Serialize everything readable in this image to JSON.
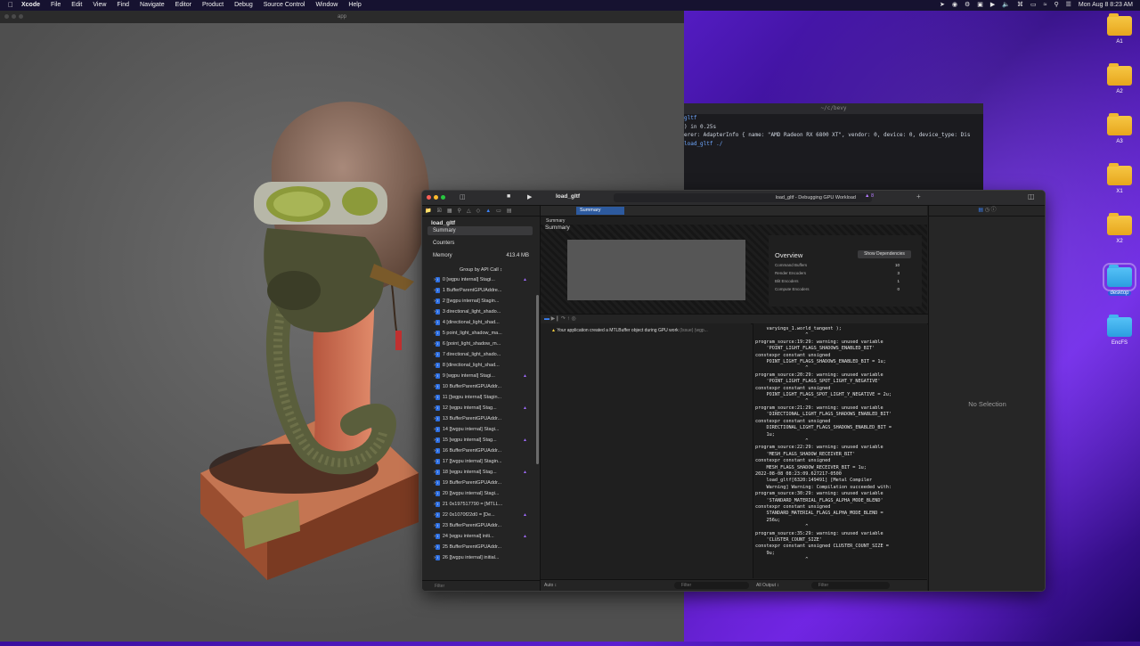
{
  "menubar": {
    "app": "Xcode",
    "items": [
      "File",
      "Edit",
      "View",
      "Find",
      "Navigate",
      "Editor",
      "Product",
      "Debug",
      "Source Control",
      "Window",
      "Help"
    ],
    "clock": "Mon Aug 8  8:23 AM"
  },
  "viewer": {
    "title": "app"
  },
  "terminal": {
    "title": "~/c/bevy",
    "lines": [
      {
        "text": "gltf",
        "blue": true
      },
      {
        "text": ") in 0.25s",
        "blue": false
      },
      {
        "text": "",
        "blue": false
      },
      {
        "text": "erer: AdapterInfo { name: \"AMD Radeon RX 6800 XT\", vendor: 0, device: 0, device_type: Dis",
        "blue": false
      },
      {
        "text": "",
        "blue": false
      },
      {
        "text": "load_gltf ./",
        "blue": true
      }
    ]
  },
  "desktop_icons": [
    "A1",
    "A2",
    "A3",
    "X1",
    "X2",
    "desktop",
    "EncFS"
  ],
  "xcode": {
    "title": "load_gltf",
    "status": "load_gltf - Debugging GPU Workload",
    "warning_count": "8",
    "navigator": {
      "root": "load_gltf",
      "summary": "Summary",
      "counters": "Counters",
      "memory_label": "Memory",
      "memory_value": "413.4 MB",
      "group_by": "Group by API Call",
      "filter_placeholder": "Filter",
      "calls": [
        {
          "text": "0 [wgpu internal] Stagi...",
          "warn": true
        },
        {
          "text": "1 BufferParentGPUAddre...",
          "warn": false
        },
        {
          "text": "2 [[wgpu internal] Stagin...",
          "warn": false
        },
        {
          "text": "3 directional_light_shado...",
          "warn": false
        },
        {
          "text": "4 [directional_light_shad...",
          "warn": false
        },
        {
          "text": "5 point_light_shadow_ma...",
          "warn": false
        },
        {
          "text": "6 [point_light_shadow_m...",
          "warn": false
        },
        {
          "text": "7 directional_light_shado...",
          "warn": false
        },
        {
          "text": "8 [directional_light_shad...",
          "warn": false
        },
        {
          "text": "9 [wgpu internal] Stagi...",
          "warn": true
        },
        {
          "text": "10 BufferParentGPUAddr...",
          "warn": false
        },
        {
          "text": "11 [[wgpu internal] Stagin...",
          "warn": false
        },
        {
          "text": "12 [wgpu internal] Stag...",
          "warn": true
        },
        {
          "text": "13 BufferParentGPUAddr...",
          "warn": false
        },
        {
          "text": "14 [[wgpu internal] Stagi...",
          "warn": false
        },
        {
          "text": "15 [wgpu internal] Stag...",
          "warn": true
        },
        {
          "text": "16 BufferParentGPUAddr...",
          "warn": false
        },
        {
          "text": "17 [[wgpu internal] Stagin...",
          "warn": false
        },
        {
          "text": "18 [wgpu internal] Stag...",
          "warn": true
        },
        {
          "text": "19 BufferParentGPUAddr...",
          "warn": false
        },
        {
          "text": "20 [[wgpu internal] Stagi...",
          "warn": false
        },
        {
          "text": "21 0x197517790 = [MTLL...",
          "warn": false
        },
        {
          "text": "22 0x1070f22d0 = [De...",
          "warn": true
        },
        {
          "text": "23 BufferParentGPUAddr...",
          "warn": false
        },
        {
          "text": "24 [wgpu internal] initi...",
          "warn": true
        },
        {
          "text": "25 BufferParentGPUAddr...",
          "warn": false
        },
        {
          "text": "26 [[wgpu internal] initial...",
          "warn": false
        }
      ]
    },
    "editor": {
      "tab": "Summary",
      "breadcrumb": "Summary",
      "summary_heading": "Summary",
      "overview": {
        "heading": "Overview",
        "button": "Show Dependencies",
        "rows": [
          {
            "label": "Command Buffers",
            "value": "10"
          },
          {
            "label": "Render Encoders",
            "value": "3"
          },
          {
            "label": "Blit Encoders",
            "value": "1"
          },
          {
            "label": "Compute Encoders",
            "value": "0"
          }
        ]
      },
      "issue": {
        "text": "Your application created a MTLBuffer object during GPU work",
        "tag": "(Issue)",
        "source": "(wgp..."
      },
      "console_lines": [
        "    varyings_1.world_tangent );",
        "                  ^",
        "program_source:19:29: warning: unused variable",
        "    'POINT_LIGHT_FLAGS_SHADOWS_ENABLED_BIT'",
        "constexpr constant unsigned",
        "    POINT_LIGHT_FLAGS_SHADOWS_ENABLED_BIT = 1u;",
        "                  ^",
        "program_source:20:29: warning: unused variable",
        "    'POINT_LIGHT_FLAGS_SPOT_LIGHT_Y_NEGATIVE'",
        "constexpr constant unsigned",
        "    POINT_LIGHT_FLAGS_SPOT_LIGHT_Y_NEGATIVE = 2u;",
        "                  ^",
        "program_source:21:29: warning: unused variable",
        "    'DIRECTIONAL_LIGHT_FLAGS_SHADOWS_ENABLED_BIT'",
        "constexpr constant unsigned",
        "    DIRECTIONAL_LIGHT_FLAGS_SHADOWS_ENABLED_BIT =",
        "    1u;",
        "                  ^",
        "program_source:22:29: warning: unused variable",
        "    'MESH_FLAGS_SHADOW_RECEIVER_BIT'",
        "constexpr constant unsigned",
        "    MESH_FLAGS_SHADOW_RECEIVER_BIT = 1u;",
        "",
        "2022-08-08 08:23:09.627217-0500",
        "    load_gltf[6320:149491] [Metal Compiler",
        "    Warning] Warning: Compilation succeeded with:",
        "",
        "program_source:30:29: warning: unused variable",
        "    'STANDARD_MATERIAL_FLAGS_ALPHA_MODE_BLEND'",
        "constexpr constant unsigned",
        "    STANDARD_MATERIAL_FLAGS_ALPHA_MODE_BLEND =",
        "    256u;",
        "                  ^",
        "program_source:35:29: warning: unused variable",
        "    'CLUSTER_COUNT_SIZE'",
        "constexpr constant unsigned CLUSTER_COUNT_SIZE =",
        "    9u;",
        "                  ^"
      ],
      "auto_label": "Auto ↕",
      "filter_placeholder": "Filter",
      "all_output": "All Output ↕"
    },
    "inspector": {
      "empty": "No Selection"
    }
  }
}
